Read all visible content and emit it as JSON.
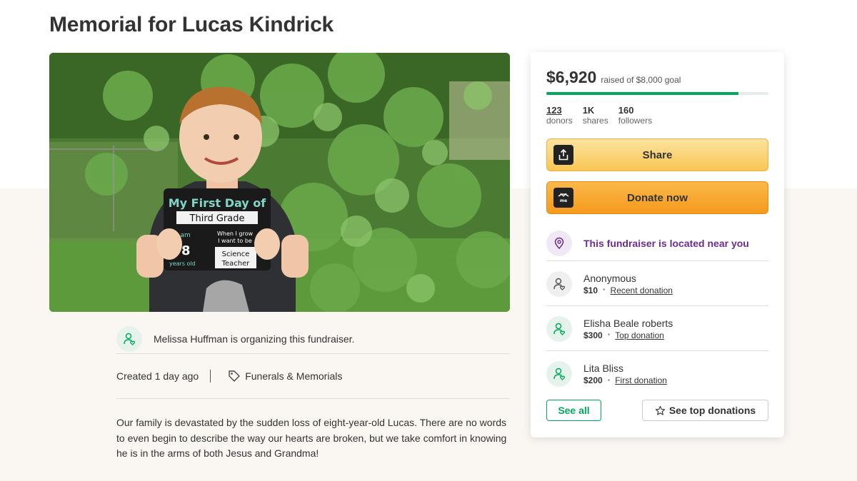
{
  "page": {
    "title": "Memorial for Lucas Kindrick"
  },
  "hero": {
    "sign_line1": "My First Day of",
    "sign_line2": "Third Grade",
    "sign_iam": "I am",
    "sign_age": "8",
    "sign_years": "years old",
    "sign_when": "When I grow",
    "sign_want": "I want to be",
    "sign_job1": "Science",
    "sign_job2": "Teacher"
  },
  "organizer": {
    "text": "Melissa Huffman is organizing this fundraiser."
  },
  "meta": {
    "created": "Created 1 day ago",
    "category": "Funerals & Memorials"
  },
  "story": {
    "text": "Our family is devastated by the sudden loss of eight-year-old Lucas. There are no words to even begin to describe the way our hearts are broken, but we take comfort in knowing he is in the arms of both Jesus and Grandma!"
  },
  "sidebar": {
    "raised_amount": "$6,920",
    "goal_text": "raised of $8,000 goal",
    "progress_fraction": 0.865,
    "stats": [
      {
        "num": "123",
        "label": "donors"
      },
      {
        "num": "1K",
        "label": "shares"
      },
      {
        "num": "160",
        "label": "followers"
      }
    ],
    "share_label": "Share",
    "donate_label": "Donate now",
    "location_text": "This fundraiser is located near you",
    "donations": [
      {
        "name": "Anonymous",
        "amount": "$10",
        "kind": "Recent donation"
      },
      {
        "name": "Elisha Beale roberts",
        "amount": "$300",
        "kind": "Top donation"
      },
      {
        "name": "Lita Bliss",
        "amount": "$200",
        "kind": "First donation"
      }
    ],
    "see_all_label": "See all",
    "see_top_label": "See top donations"
  },
  "colors": {
    "green": "#02a95c",
    "purple": "#6b2c8f",
    "share_yellow": "#f9c653",
    "donate_orange": "#f59a1c"
  }
}
